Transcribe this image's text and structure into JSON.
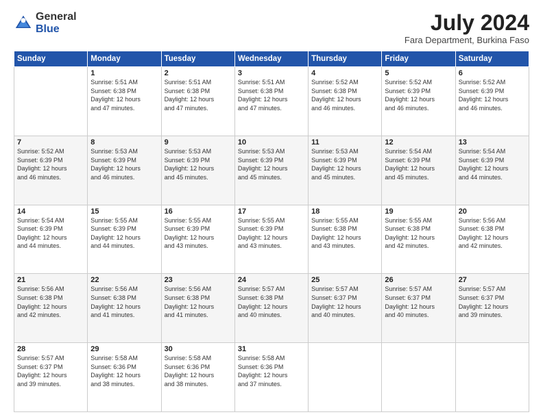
{
  "logo": {
    "general": "General",
    "blue": "Blue"
  },
  "header": {
    "month_year": "July 2024",
    "location": "Fara Department, Burkina Faso"
  },
  "days_of_week": [
    "Sunday",
    "Monday",
    "Tuesday",
    "Wednesday",
    "Thursday",
    "Friday",
    "Saturday"
  ],
  "weeks": [
    [
      {
        "day": "",
        "info": ""
      },
      {
        "day": "1",
        "info": "Sunrise: 5:51 AM\nSunset: 6:38 PM\nDaylight: 12 hours\nand 47 minutes."
      },
      {
        "day": "2",
        "info": "Sunrise: 5:51 AM\nSunset: 6:38 PM\nDaylight: 12 hours\nand 47 minutes."
      },
      {
        "day": "3",
        "info": "Sunrise: 5:51 AM\nSunset: 6:38 PM\nDaylight: 12 hours\nand 47 minutes."
      },
      {
        "day": "4",
        "info": "Sunrise: 5:52 AM\nSunset: 6:38 PM\nDaylight: 12 hours\nand 46 minutes."
      },
      {
        "day": "5",
        "info": "Sunrise: 5:52 AM\nSunset: 6:39 PM\nDaylight: 12 hours\nand 46 minutes."
      },
      {
        "day": "6",
        "info": "Sunrise: 5:52 AM\nSunset: 6:39 PM\nDaylight: 12 hours\nand 46 minutes."
      }
    ],
    [
      {
        "day": "7",
        "info": "Sunrise: 5:52 AM\nSunset: 6:39 PM\nDaylight: 12 hours\nand 46 minutes."
      },
      {
        "day": "8",
        "info": "Sunrise: 5:53 AM\nSunset: 6:39 PM\nDaylight: 12 hours\nand 46 minutes."
      },
      {
        "day": "9",
        "info": "Sunrise: 5:53 AM\nSunset: 6:39 PM\nDaylight: 12 hours\nand 45 minutes."
      },
      {
        "day": "10",
        "info": "Sunrise: 5:53 AM\nSunset: 6:39 PM\nDaylight: 12 hours\nand 45 minutes."
      },
      {
        "day": "11",
        "info": "Sunrise: 5:53 AM\nSunset: 6:39 PM\nDaylight: 12 hours\nand 45 minutes."
      },
      {
        "day": "12",
        "info": "Sunrise: 5:54 AM\nSunset: 6:39 PM\nDaylight: 12 hours\nand 45 minutes."
      },
      {
        "day": "13",
        "info": "Sunrise: 5:54 AM\nSunset: 6:39 PM\nDaylight: 12 hours\nand 44 minutes."
      }
    ],
    [
      {
        "day": "14",
        "info": "Sunrise: 5:54 AM\nSunset: 6:39 PM\nDaylight: 12 hours\nand 44 minutes."
      },
      {
        "day": "15",
        "info": "Sunrise: 5:55 AM\nSunset: 6:39 PM\nDaylight: 12 hours\nand 44 minutes."
      },
      {
        "day": "16",
        "info": "Sunrise: 5:55 AM\nSunset: 6:39 PM\nDaylight: 12 hours\nand 43 minutes."
      },
      {
        "day": "17",
        "info": "Sunrise: 5:55 AM\nSunset: 6:39 PM\nDaylight: 12 hours\nand 43 minutes."
      },
      {
        "day": "18",
        "info": "Sunrise: 5:55 AM\nSunset: 6:38 PM\nDaylight: 12 hours\nand 43 minutes."
      },
      {
        "day": "19",
        "info": "Sunrise: 5:55 AM\nSunset: 6:38 PM\nDaylight: 12 hours\nand 42 minutes."
      },
      {
        "day": "20",
        "info": "Sunrise: 5:56 AM\nSunset: 6:38 PM\nDaylight: 12 hours\nand 42 minutes."
      }
    ],
    [
      {
        "day": "21",
        "info": "Sunrise: 5:56 AM\nSunset: 6:38 PM\nDaylight: 12 hours\nand 42 minutes."
      },
      {
        "day": "22",
        "info": "Sunrise: 5:56 AM\nSunset: 6:38 PM\nDaylight: 12 hours\nand 41 minutes."
      },
      {
        "day": "23",
        "info": "Sunrise: 5:56 AM\nSunset: 6:38 PM\nDaylight: 12 hours\nand 41 minutes."
      },
      {
        "day": "24",
        "info": "Sunrise: 5:57 AM\nSunset: 6:38 PM\nDaylight: 12 hours\nand 40 minutes."
      },
      {
        "day": "25",
        "info": "Sunrise: 5:57 AM\nSunset: 6:37 PM\nDaylight: 12 hours\nand 40 minutes."
      },
      {
        "day": "26",
        "info": "Sunrise: 5:57 AM\nSunset: 6:37 PM\nDaylight: 12 hours\nand 40 minutes."
      },
      {
        "day": "27",
        "info": "Sunrise: 5:57 AM\nSunset: 6:37 PM\nDaylight: 12 hours\nand 39 minutes."
      }
    ],
    [
      {
        "day": "28",
        "info": "Sunrise: 5:57 AM\nSunset: 6:37 PM\nDaylight: 12 hours\nand 39 minutes."
      },
      {
        "day": "29",
        "info": "Sunrise: 5:58 AM\nSunset: 6:36 PM\nDaylight: 12 hours\nand 38 minutes."
      },
      {
        "day": "30",
        "info": "Sunrise: 5:58 AM\nSunset: 6:36 PM\nDaylight: 12 hours\nand 38 minutes."
      },
      {
        "day": "31",
        "info": "Sunrise: 5:58 AM\nSunset: 6:36 PM\nDaylight: 12 hours\nand 37 minutes."
      },
      {
        "day": "",
        "info": ""
      },
      {
        "day": "",
        "info": ""
      },
      {
        "day": "",
        "info": ""
      }
    ]
  ]
}
